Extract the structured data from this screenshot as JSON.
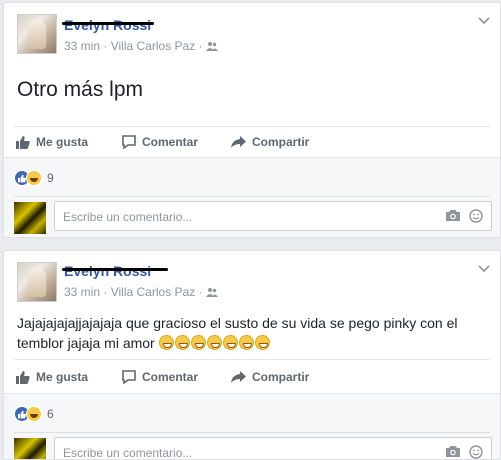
{
  "posts": [
    {
      "author": "Evelyn Rossi",
      "time": "33 min",
      "location": "Villa Carlos Paz",
      "separator": "·",
      "body": "Otro más lpm",
      "actions": {
        "like": "Me gusta",
        "comment": "Comentar",
        "share": "Compartir"
      },
      "reaction_count": "9",
      "comment_placeholder": "Escribe un comentario..."
    },
    {
      "author": "Evelyn Rossi",
      "time": "33 min",
      "location": "Villa Carlos Paz",
      "separator": "·",
      "body_line1": "Jajajajajajjajajaja que gracioso el susto de su vida se pego pinky con el",
      "body_line2": "temblor jajaja mi amor",
      "emoji_count": 7,
      "actions": {
        "like": "Me gusta",
        "comment": "Comentar",
        "share": "Compartir"
      },
      "reaction_count": "6",
      "comment_placeholder": "Escribe un comentario..."
    }
  ],
  "colors": {
    "name": "#365899",
    "meta": "#90949c",
    "like_blue": "#4267b2",
    "background": "#e9ebee"
  }
}
